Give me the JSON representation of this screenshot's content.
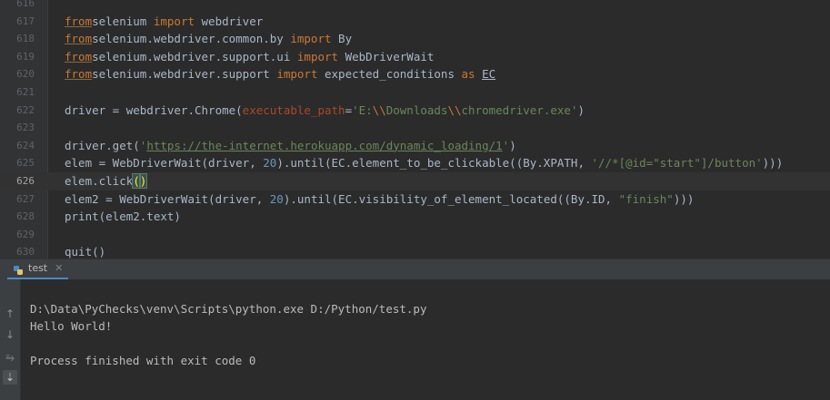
{
  "editor": {
    "lines": [
      {
        "num": "616",
        "segments": []
      },
      {
        "num": "617",
        "segments": [
          [
            "kw",
            "from"
          ],
          [
            "",
            "selenium "
          ],
          [
            "kw2",
            "import"
          ],
          [
            "",
            " webdriver"
          ]
        ]
      },
      {
        "num": "618",
        "segments": [
          [
            "kw",
            "from"
          ],
          [
            "",
            ""
          ],
          [
            "",
            "selenium.webdriver.common.by "
          ],
          [
            "kw2",
            "import"
          ],
          [
            "",
            " By"
          ]
        ]
      },
      {
        "num": "619",
        "segments": [
          [
            "kw",
            "from"
          ],
          [
            "",
            "selenium.webdriver.support.ui "
          ],
          [
            "kw2",
            "import"
          ],
          [
            "",
            " WebDriverWait"
          ]
        ]
      },
      {
        "num": "620",
        "segments": [
          [
            "kw",
            "from"
          ],
          [
            "",
            "selenium.webdriver.support "
          ],
          [
            "kw2",
            "import"
          ],
          [
            "",
            " expected_conditions "
          ],
          [
            "kw2",
            "as"
          ],
          [
            "",
            " "
          ],
          [
            "ul",
            "EC"
          ]
        ]
      },
      {
        "num": "621",
        "segments": []
      },
      {
        "num": "622",
        "segments": [
          [
            "",
            "driver = webdriver.Chrome("
          ],
          [
            "param",
            "executable_path"
          ],
          [
            "",
            "="
          ],
          [
            "str",
            "'E:"
          ],
          [
            "esc",
            "\\\\"
          ],
          [
            "str",
            "Downloads"
          ],
          [
            "esc",
            "\\\\"
          ],
          [
            "str",
            "chromedriver.exe'"
          ],
          [
            "",
            ")"
          ]
        ]
      },
      {
        "num": "623",
        "segments": []
      },
      {
        "num": "624",
        "segments": [
          [
            "",
            "driver.get("
          ],
          [
            "str",
            "'"
          ],
          [
            "strul",
            "https://the-internet.herokuapp.com/dynamic_loading/1"
          ],
          [
            "str",
            "'"
          ],
          [
            "",
            ")"
          ]
        ]
      },
      {
        "num": "625",
        "segments": [
          [
            "",
            "elem = WebDriverWait(driver, "
          ],
          [
            "num",
            "20"
          ],
          [
            "",
            ").until(EC.element_to_be_clickable((By.XPATH, "
          ],
          [
            "str",
            "'//*[@id=\"start\"]/button'"
          ],
          [
            "",
            ")))"
          ]
        ]
      },
      {
        "num": "626",
        "current": true,
        "segments": [
          [
            "",
            "elem.click"
          ],
          [
            "bracket",
            "("
          ],
          [
            "caret",
            ""
          ],
          [
            "bracket",
            ")"
          ]
        ]
      },
      {
        "num": "627",
        "segments": [
          [
            "",
            "elem2 = WebDriverWait(driver, "
          ],
          [
            "num",
            "20"
          ],
          [
            "",
            ").until(EC.visibility_of_element_located((By.ID, "
          ],
          [
            "str",
            "\"finish\""
          ],
          [
            "",
            ")))"
          ]
        ]
      },
      {
        "num": "628",
        "segments": [
          [
            "",
            "print(elem2.text)"
          ]
        ]
      },
      {
        "num": "629",
        "segments": []
      },
      {
        "num": "630",
        "segments": [
          [
            "",
            "quit()"
          ]
        ]
      }
    ]
  },
  "run_panel": {
    "tab_label": "test",
    "console_lines": [
      "D:\\Data\\PyChecks\\venv\\Scripts\\python.exe D:/Python/test.py",
      "Hello World!",
      "",
      "Process finished with exit code 0"
    ]
  },
  "colors": {
    "keyword": "#cc7832",
    "string": "#6a8759",
    "number": "#6897bb",
    "parameter": "#aa4926"
  }
}
